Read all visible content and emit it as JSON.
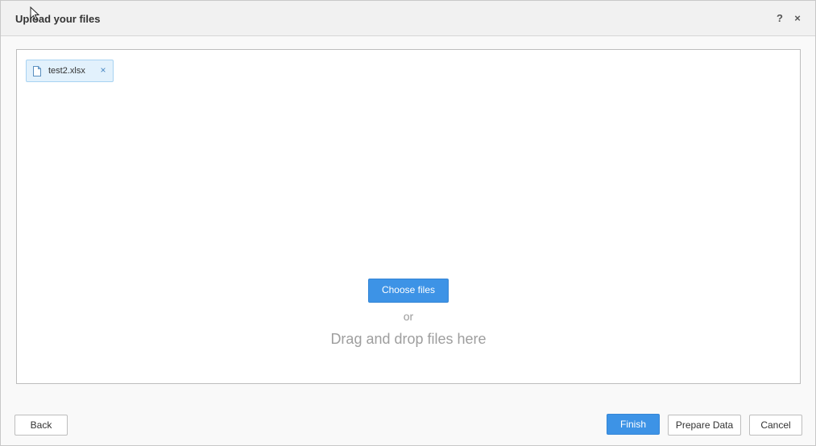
{
  "dialog": {
    "title": "Upload your files",
    "help_label": "?",
    "close_label": "×"
  },
  "dropzone": {
    "files": [
      {
        "name": "test2.xlsx",
        "icon": "file-icon",
        "remove_label": "×"
      }
    ],
    "choose_label": "Choose files",
    "or_label": "or",
    "drag_label": "Drag and drop files here"
  },
  "footer": {
    "back_label": "Back",
    "finish_label": "Finish",
    "prepare_label": "Prepare Data",
    "cancel_label": "Cancel"
  },
  "colors": {
    "accent": "#3d93e6",
    "chip_background": "#e2f1fc",
    "chip_border": "#a8d3f2"
  }
}
